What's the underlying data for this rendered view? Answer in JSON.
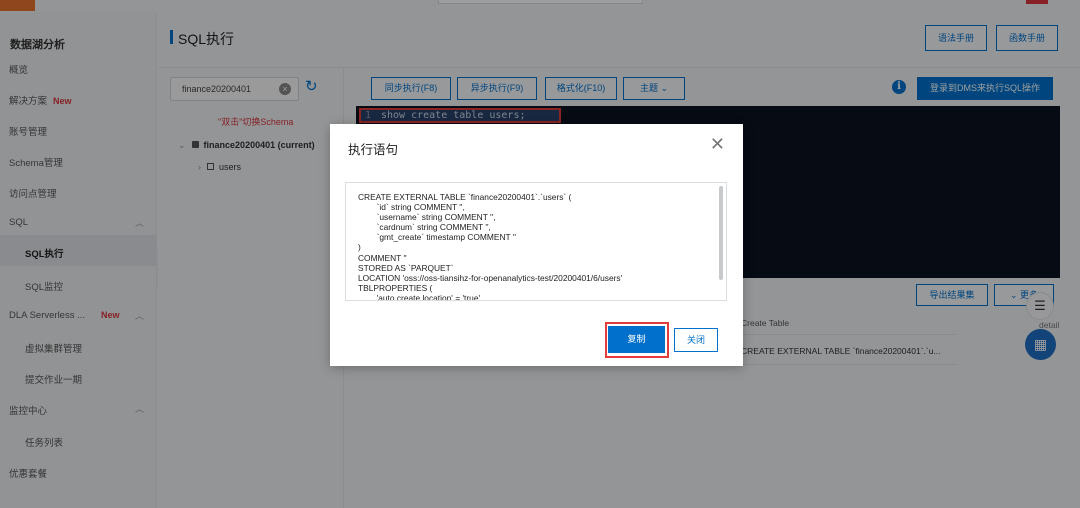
{
  "sidebar": {
    "title": "数据湖分析",
    "items": [
      {
        "label": "概览"
      },
      {
        "label": "解决方案",
        "badge": "New"
      },
      {
        "label": "账号管理"
      },
      {
        "label": "Schema管理"
      },
      {
        "label": "访问点管理"
      },
      {
        "label": "SQL"
      },
      {
        "label": "SQL执行"
      },
      {
        "label": "SQL监控"
      },
      {
        "label": "DLA Serverless ...",
        "badge": "New"
      },
      {
        "label": "虚拟集群管理"
      },
      {
        "label": "提交作业一期"
      },
      {
        "label": "监控中心"
      },
      {
        "label": "任务列表"
      },
      {
        "label": "优惠套餐"
      }
    ],
    "active_item": "SQL执行"
  },
  "header": {
    "title": "SQL执行",
    "syntax_manual": "语法手册",
    "function_manual": "函数手册"
  },
  "schema_panel": {
    "selected_schema": "finance20200401",
    "hint": "\"双击\"切换Schema",
    "tree": {
      "database": "finance20200401 (current)",
      "table": "users"
    }
  },
  "toolbar": {
    "sync_exec": "同步执行(F8)",
    "async_exec": "异步执行(F9)",
    "format": "格式化(F10)",
    "theme": "主题",
    "dms_exec": "登录到DMS来执行SQL操作"
  },
  "editor": {
    "line_number": "1",
    "code": "show create table users;"
  },
  "results": {
    "export_label": "导出结果集",
    "more_label": "更多",
    "column_header": "Create Table",
    "cell_value": "CREATE EXTERNAL TABLE `finance20200401`.`u...",
    "detail_label": "detail"
  },
  "modal": {
    "title": "执行语句",
    "sql_lines": [
      "CREATE EXTERNAL TABLE `finance20200401`.`users` (",
      "        `id` string COMMENT '',",
      "        `username` string COMMENT '',",
      "        `cardnum` string COMMENT '',",
      "        `gmt_create` timestamp COMMENT ''",
      ")",
      "COMMENT ''",
      "STORED AS `PARQUET`",
      "LOCATION 'oss://oss-tiansihz-for-openanalytics-test/20200401/6/users'",
      "TBLPROPERTIES (",
      "        'auto.create.location' = 'true'"
    ],
    "copy_label": "复制",
    "close_label": "关闭"
  },
  "colors": {
    "primary": "#0070cc",
    "highlight_red": "#e23b3b",
    "editor_bg": "#0b1321",
    "new_badge": "#d9363e"
  }
}
